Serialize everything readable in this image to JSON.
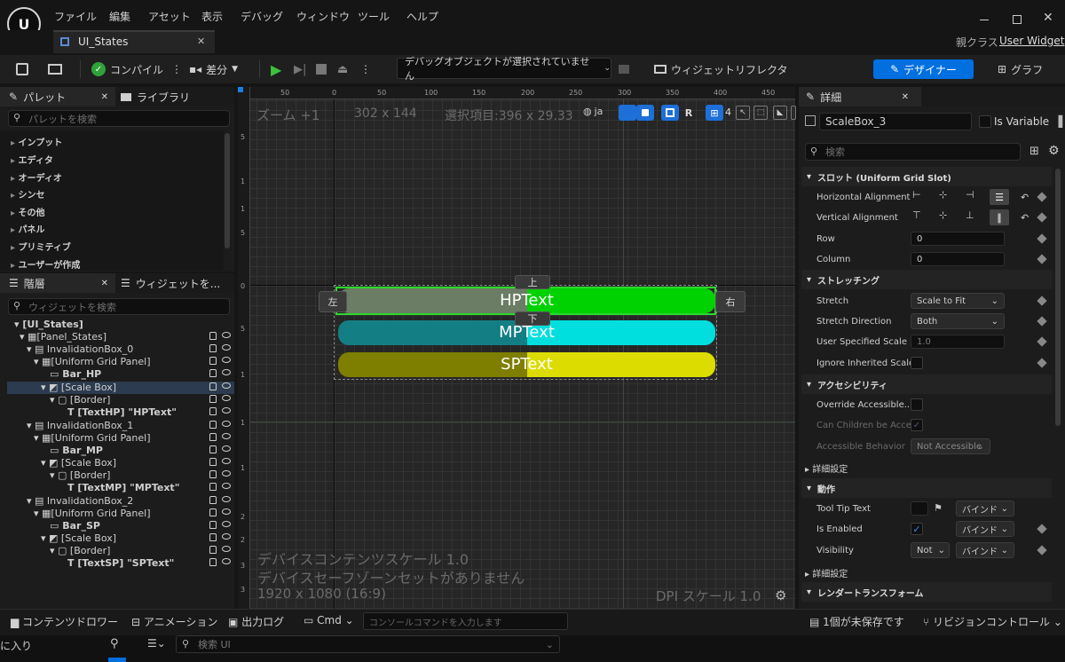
{
  "menu": [
    "ファイル",
    "編集",
    "アセット",
    "表示",
    "デバッグ",
    "ウィンドウ",
    "ツール",
    "ヘルプ"
  ],
  "tab": {
    "title": "UI_States"
  },
  "parent_class": {
    "label": "親クラス",
    "value": "User Widget"
  },
  "toolbar": {
    "compile": "コンパイル",
    "diff": "差分",
    "debug_object": "デバッグオブジェクトが選択されていません",
    "widget_reflector": "ウィジェットリフレクタ",
    "designer": "デザイナー",
    "graph": "グラフ"
  },
  "palette": {
    "tab": "パレット",
    "library_tab": "ライブラリ",
    "search_placeholder": "パレットを検索",
    "categories": [
      "インプット",
      "エディタ",
      "オーディオ",
      "シンセ",
      "その他",
      "パネル",
      "プリミティブ",
      "ユーザーが作成"
    ]
  },
  "hierarchy": {
    "tab": "階層",
    "widget_tab": "ウィジェットを...",
    "search_placeholder": "ウィジェットを検索",
    "items": [
      {
        "label": "[UI_States]"
      },
      {
        "label": "[Panel_States]"
      },
      {
        "label": "InvalidationBox_0"
      },
      {
        "label": "[Uniform Grid Panel]"
      },
      {
        "label": "Bar_HP"
      },
      {
        "label": "[Scale Box]"
      },
      {
        "label": "[Border]"
      },
      {
        "label": "[TextHP] \"HPText\""
      },
      {
        "label": "InvalidationBox_1"
      },
      {
        "label": "[Uniform Grid Panel]"
      },
      {
        "label": "Bar_MP"
      },
      {
        "label": "[Scale Box]"
      },
      {
        "label": "[Border]"
      },
      {
        "label": "[TextMP] \"MPText\""
      },
      {
        "label": "InvalidationBox_2"
      },
      {
        "label": "[Uniform Grid Panel]"
      },
      {
        "label": "Bar_SP"
      },
      {
        "label": "[Scale Box]"
      },
      {
        "label": "[Border]"
      },
      {
        "label": "[TextSP] \"SPText\""
      }
    ]
  },
  "canvas": {
    "zoom": "ズーム +1",
    "size": "302 x 144",
    "selection": "選択項目:396 x 29.33",
    "lang": "ja",
    "grid_num": "4",
    "r_label": "R",
    "ruler_top": [
      "50",
      "0",
      "50",
      "100",
      "150",
      "200",
      "250",
      "300",
      "350",
      "400",
      "450"
    ],
    "ruler_left": [
      "5",
      "1",
      "1",
      "5",
      "0",
      "5",
      "1",
      "1",
      "1",
      "2",
      "2",
      "3",
      "3"
    ],
    "dev_scale": "デバイスコンテンツスケール 1.0",
    "safe_zone": "デバイスセーフゾーンセットがありません",
    "resolution": "1920 x 1080 (16:9)",
    "dpi": "DPI スケール 1.0",
    "anchor_top": "上",
    "anchor_bottom": "下",
    "anchor_left": "左",
    "anchor_right": "右",
    "bars": [
      {
        "text": "HPText",
        "fill": 0.5,
        "color": "#00d100",
        "bg": "#6b7d64"
      },
      {
        "text": "MPText",
        "fill": 0.5,
        "color": "#00dede",
        "bg": "#137f84"
      },
      {
        "text": "SPText",
        "fill": 0.5,
        "color": "#dcdc00",
        "bg": "#7e7e00"
      }
    ]
  },
  "details": {
    "tab": "詳細",
    "name": "ScaleBox_3",
    "is_variable": "Is Variable",
    "search_placeholder": "検索",
    "slot_section": "スロット (Uniform Grid Slot)",
    "h_align": "Horizontal Alignment",
    "v_align": "Vertical Alignment",
    "row": "Row",
    "row_value": "0",
    "column": "Column",
    "column_value": "0",
    "stretching_section": "ストレッチング",
    "stretch": "Stretch",
    "stretch_value": "Scale to Fit",
    "stretch_direction": "Stretch Direction",
    "stretch_direction_value": "Both",
    "user_scale": "User Specified Scale",
    "user_scale_value": "1.0",
    "ignore_scale": "Ignore Inherited Scale",
    "access_section": "アクセシビリティ",
    "override_access": "Override Accessible...",
    "can_children": "Can Children be Acce...",
    "access_behavior": "Accessible Behavior",
    "access_behavior_value": "Not Accessible",
    "advanced": "詳細設定",
    "behavior_section": "動作",
    "tooltip": "Tool Tip Text",
    "bind": "バインド",
    "is_enabled": "Is Enabled",
    "visibility": "Visibility",
    "visibility_value": "Not",
    "advanced2": "詳細設定",
    "render_section": "レンダートランスフォーム"
  },
  "bottom": {
    "content_drawer": "コンテンツドロワー",
    "animation": "アニメーション",
    "output_log": "出力ログ",
    "cmd": "Cmd",
    "console_placeholder": "コンソールコマンドを入力します",
    "unsaved": "1個が未保存です",
    "revision": "リビジョンコントロール"
  },
  "footer": {
    "favorites": "に入り",
    "search_placeholder": "検索 UI"
  },
  "colors": {
    "accent": "#0070e0",
    "hp": "#00d100",
    "mp": "#00dede",
    "sp": "#dcdc00"
  }
}
